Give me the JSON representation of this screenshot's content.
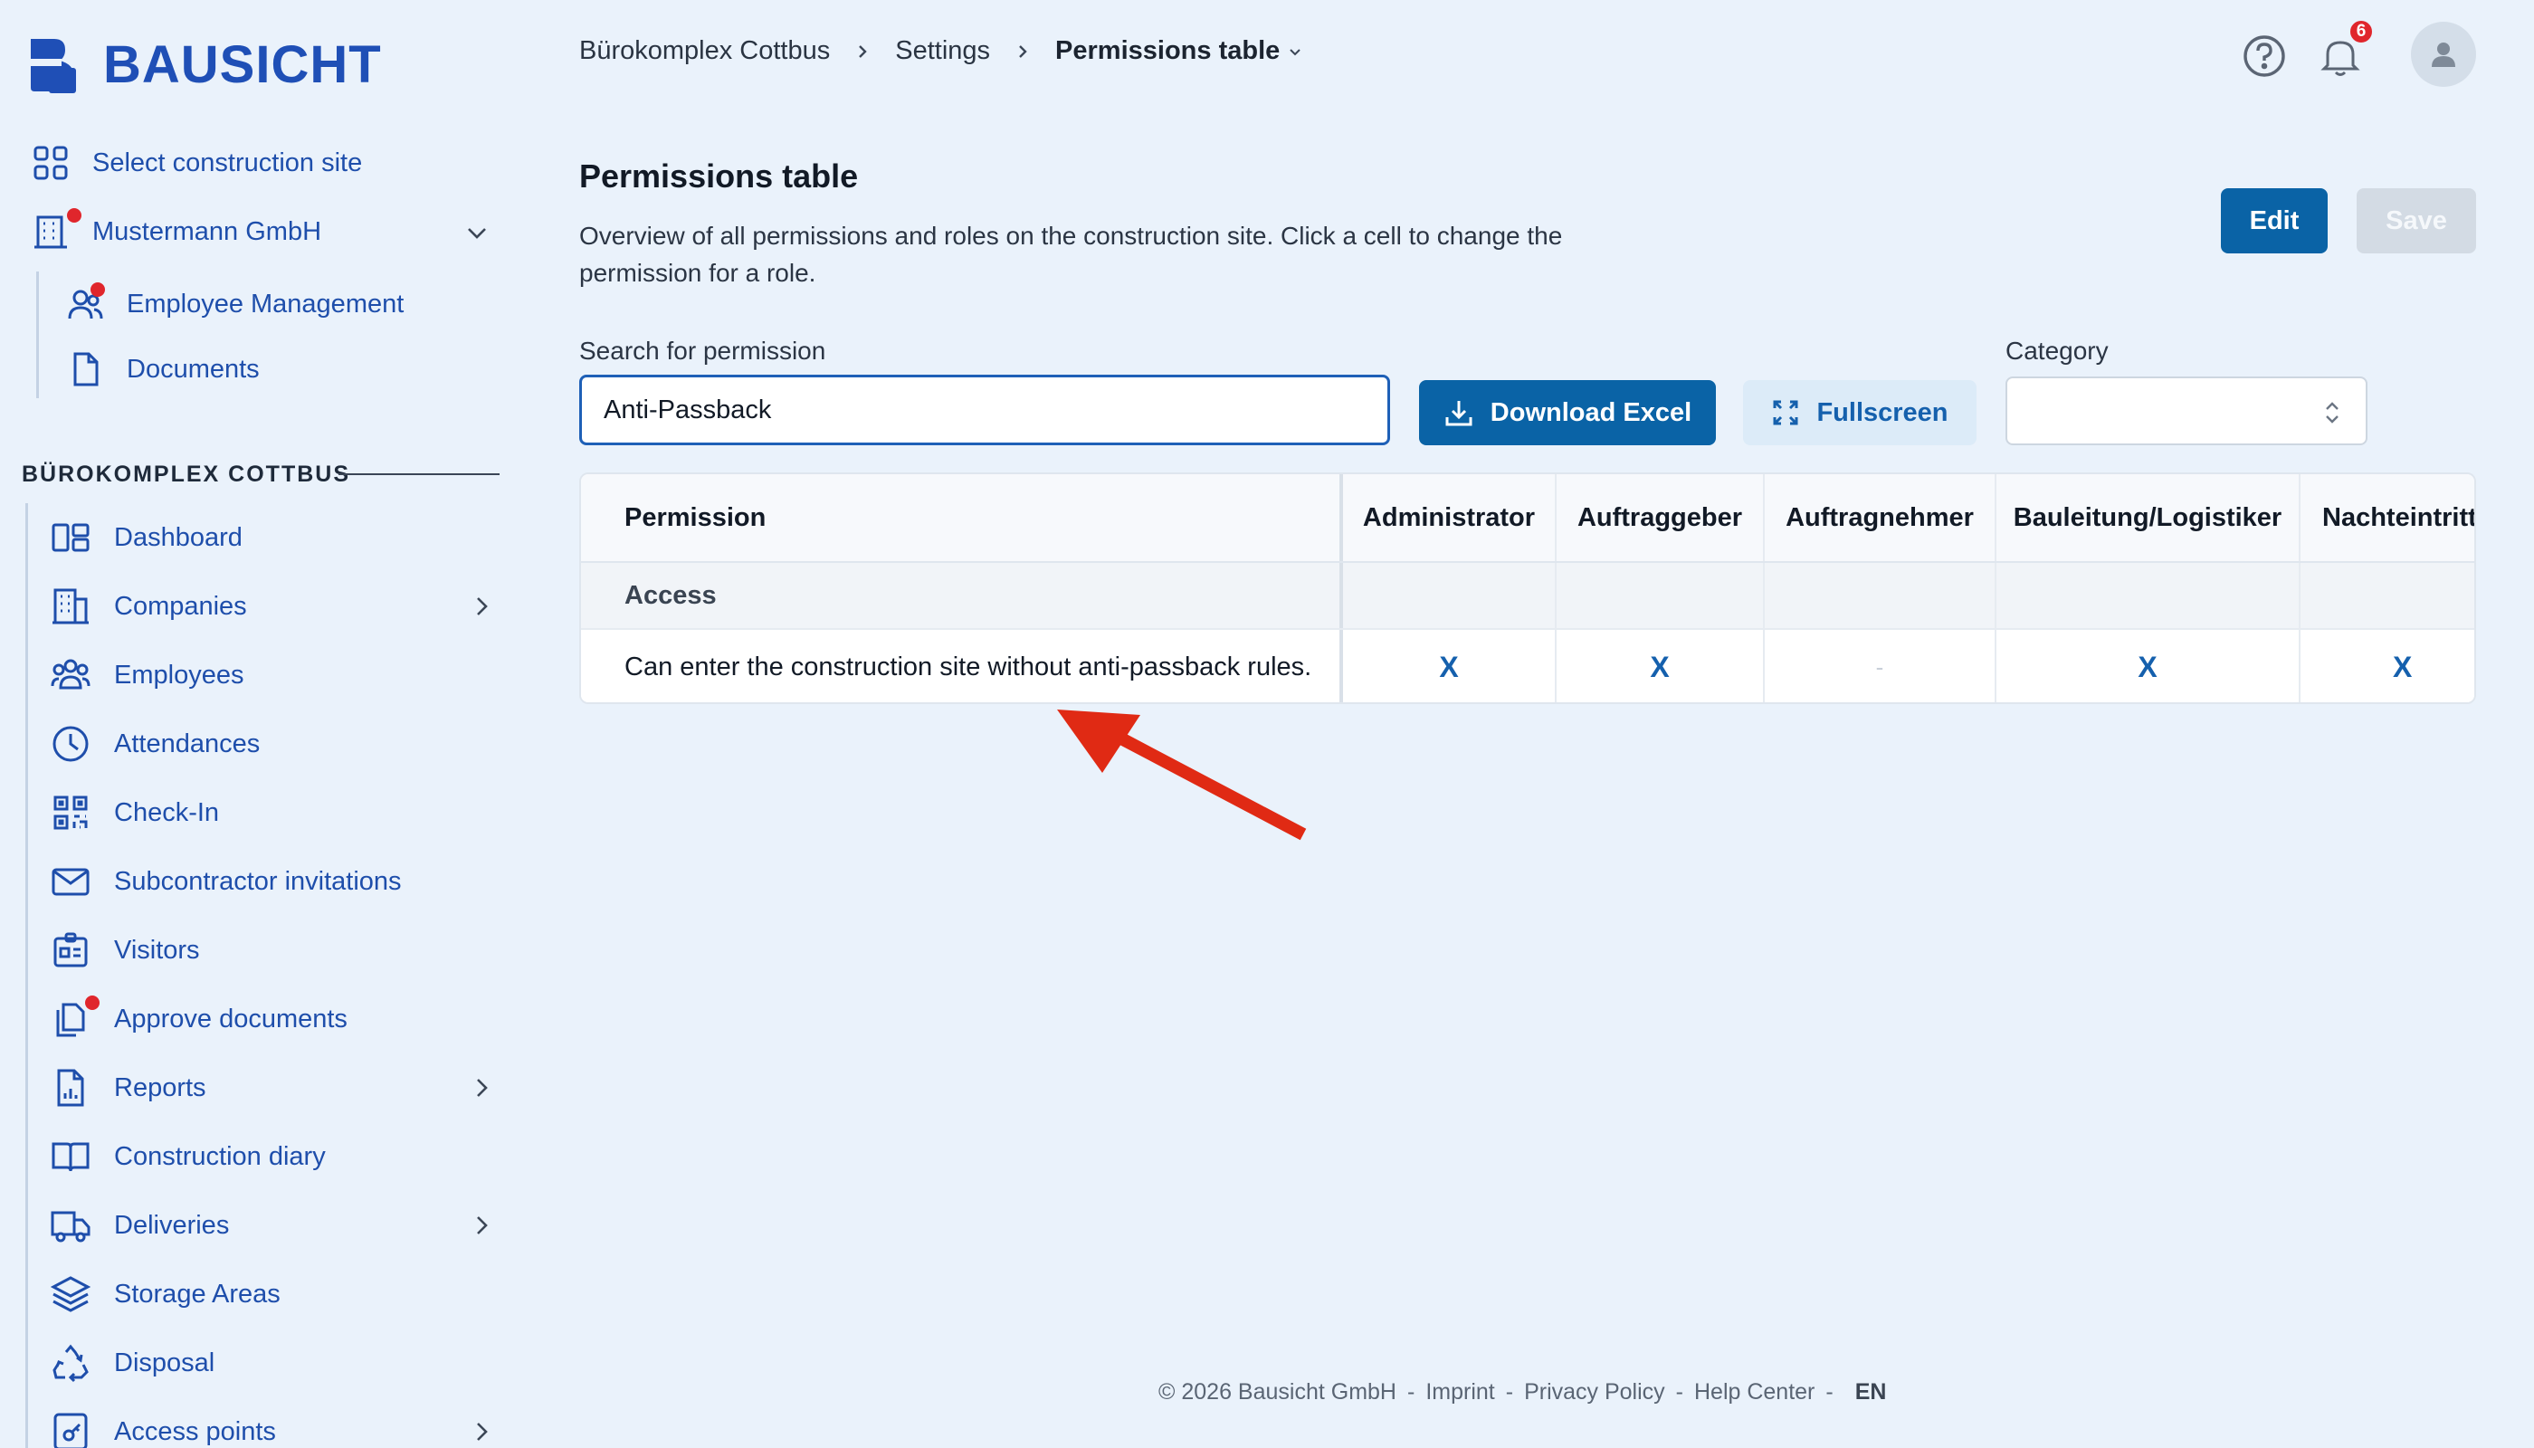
{
  "brand": {
    "name": "BAUSICHT"
  },
  "top_nav": {
    "select_site": "Select construction site",
    "company": "Mustermann GmbH",
    "employee_management": "Employee Management",
    "documents": "Documents"
  },
  "section": {
    "title": "BÜROKOMPLEX COTTBUS"
  },
  "nav": [
    {
      "label": "Dashboard"
    },
    {
      "label": "Companies"
    },
    {
      "label": "Employees"
    },
    {
      "label": "Attendances"
    },
    {
      "label": "Check-In"
    },
    {
      "label": "Subcontractor invitations"
    },
    {
      "label": "Visitors"
    },
    {
      "label": "Approve documents"
    },
    {
      "label": "Reports"
    },
    {
      "label": "Construction diary"
    },
    {
      "label": "Deliveries"
    },
    {
      "label": "Storage Areas"
    },
    {
      "label": "Disposal"
    },
    {
      "label": "Access points"
    }
  ],
  "breadcrumb": {
    "site": "Bürokomplex Cottbus",
    "settings": "Settings",
    "current": "Permissions table"
  },
  "notifications": {
    "count": "6"
  },
  "page": {
    "title": "Permissions table",
    "description": "Overview of all permissions and roles on the construction site. Click a cell to change the permission for a role."
  },
  "actions": {
    "edit": "Edit",
    "save": "Save",
    "download": "Download Excel",
    "fullscreen": "Fullscreen"
  },
  "search": {
    "label": "Search for permission",
    "value": "Anti-Passback"
  },
  "category": {
    "label": "Category",
    "value": ""
  },
  "table": {
    "columns": [
      "Permission",
      "Administrator",
      "Auftraggeber",
      "Auftragnehmer",
      "Bauleitung/Logistiker",
      "Nachteintritt"
    ],
    "category_row": "Access",
    "row": {
      "permission": "Can enter the construction site without anti-passback rules.",
      "values": [
        "X",
        "X",
        "-",
        "X",
        "X"
      ]
    }
  },
  "footer": {
    "copyright": "© 2026 Bausicht GmbH",
    "sep": "-",
    "imprint": "Imprint",
    "privacy": "Privacy Policy",
    "help": "Help Center",
    "lang": "EN"
  },
  "colors": {
    "primary": "#0a63a6",
    "link": "#1e4eab",
    "accent_red": "#e0262c",
    "annotation_arrow": "#e02a14",
    "background": "#eaf2fb"
  }
}
